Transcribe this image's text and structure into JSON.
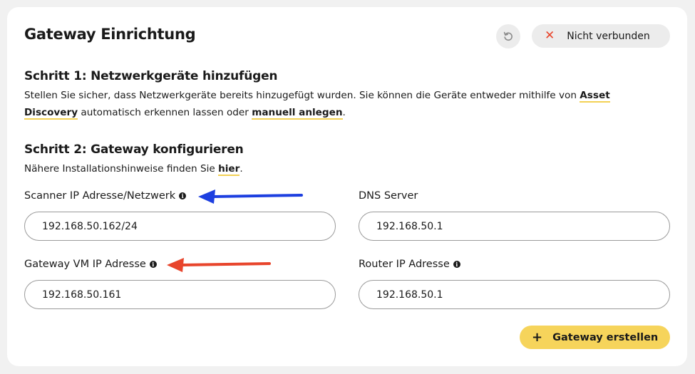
{
  "header": {
    "title": "Gateway Einrichtung",
    "reset_icon": "reset-icon",
    "status_label": "Nicht verbunden",
    "status_icon": "close-icon",
    "status_color": "#e8452c"
  },
  "step1": {
    "heading": "Schritt 1: Netzwerkgeräte hinzufügen",
    "text_before": "Stellen Sie sicher, dass Netzwerkgeräte bereits hinzugefügt wurden. Sie können die Geräte entweder mithilfe von ",
    "link_asset": "Asset Discovery",
    "text_middle": " automatisch erkennen lassen oder ",
    "link_manual": "manuell anlegen",
    "text_after": "."
  },
  "step2": {
    "heading": "Schritt 2: Gateway konfigurieren",
    "text_before": "Nähere Installationshinweise finden Sie ",
    "link_here": "hier",
    "text_after": "."
  },
  "form": {
    "scanner_label": "Scanner IP Adresse/Netzwerk",
    "scanner_value": "192.168.50.162/24",
    "dns_label": "DNS Server",
    "dns_value": "192.168.50.1",
    "gateway_vm_label": "Gateway VM IP Adresse",
    "gateway_vm_value": "192.168.50.161",
    "router_label": "Router IP Adresse",
    "router_value": "192.168.50.1",
    "info_icon": "info-icon"
  },
  "actions": {
    "create_label": "Gateway erstellen",
    "create_icon": "plus-icon"
  },
  "colors": {
    "accent": "#f6d45b",
    "link_underline": "#f3d155",
    "arrow_blue": "#1d3fe0",
    "arrow_red": "#e8452c"
  }
}
